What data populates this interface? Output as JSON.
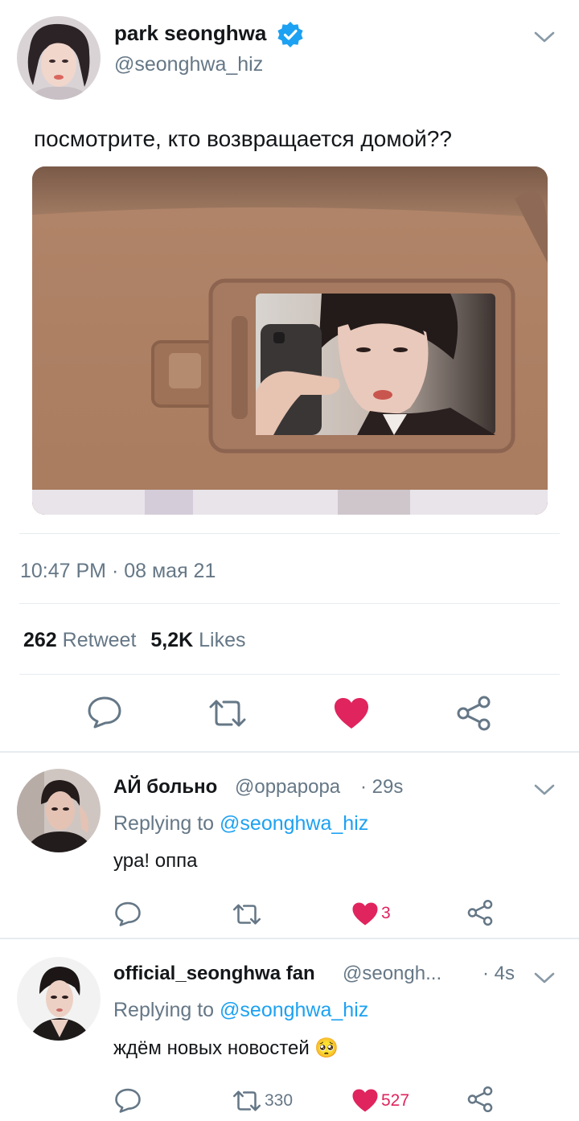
{
  "main_tweet": {
    "author_name": "park seonghwa",
    "author_handle": "@seonghwa_hiz",
    "verified": true,
    "text": "посмотрите, кто возвращается домой??",
    "timestamp": "10:47 PM · 08 мая 21",
    "retweet_count": "262",
    "retweet_label": "Retweet",
    "like_count": "5,2K",
    "like_label": "Likes",
    "liked": true,
    "icons": [
      "reply-icon",
      "retweet-icon",
      "heart-icon",
      "share-icon"
    ]
  },
  "replies": [
    {
      "name": "АЙ больно",
      "handle": "@oppapopa",
      "time": "· 29s",
      "replying_prefix": "Replying to",
      "replying_to": "@seonghwa_hiz",
      "text": "ура! оппа",
      "retweets": "",
      "likes": "3",
      "liked": true
    },
    {
      "name": "official_seonghwa fan",
      "handle": "@seongh...",
      "time": "· 4s",
      "replying_prefix": "Replying to",
      "replying_to": "@seonghwa_hiz",
      "text": "ждём новых новостей 🥺",
      "retweets": "330",
      "likes": "527",
      "liked": true
    }
  ],
  "colors": {
    "accent": "#1da1f2",
    "like": "#e0245e",
    "secondary_text": "#657786",
    "icon": "#657786"
  }
}
